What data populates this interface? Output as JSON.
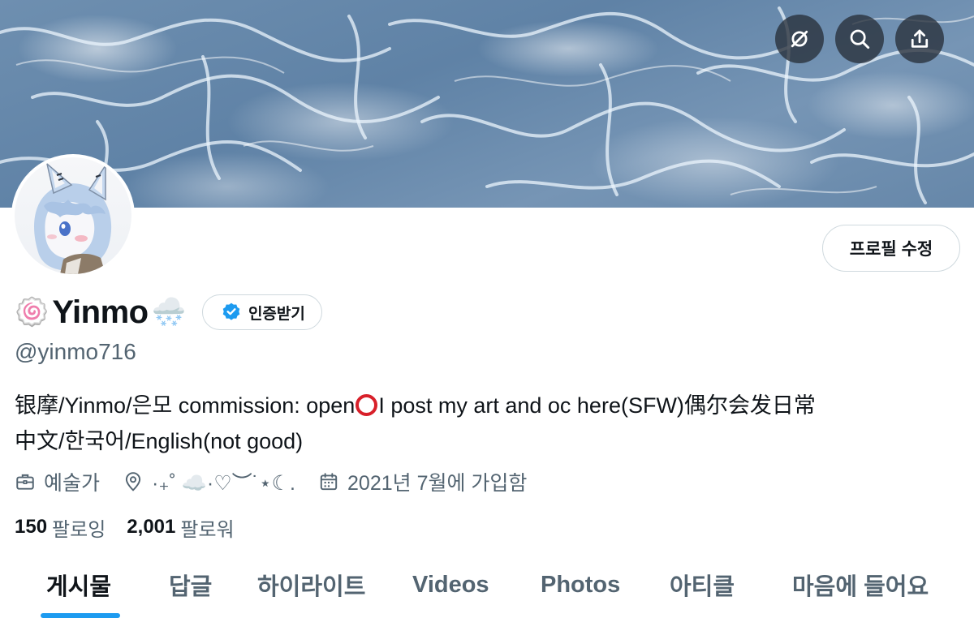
{
  "colors": {
    "accent": "#1d9bf0",
    "text_primary": "#0f1419",
    "text_secondary": "#536471",
    "border": "#cfd9de",
    "open_ring": "#d8202a"
  },
  "header": {
    "icons": [
      "hide-eye-slash-icon",
      "search-icon",
      "share-icon"
    ]
  },
  "profile": {
    "display_name": "Yinmo",
    "name_prefix_emoji": "🍥",
    "name_suffix_emoji": "🌨️",
    "verify_label": "인증받기",
    "edit_profile_label": "프로필 수정",
    "handle": "@yinmo716",
    "bio_part1": "银摩/Yinmo/은모 commission: open",
    "bio_part2": "I post my art and oc here(SFW)偶尔会发日常",
    "bio_line2": "中文/한국어/English(not good)",
    "occupation": "예술가",
    "location": "·₊˚ ☁️·♡︶˙⋆☾.",
    "joined": "2021년 7월에 가입함",
    "following_count": "150",
    "following_label": "팔로잉",
    "followers_count": "2,001",
    "followers_label": "팔로워"
  },
  "tabs": [
    {
      "label": "게시물",
      "active": true
    },
    {
      "label": "답글",
      "active": false
    },
    {
      "label": "하이라이트",
      "active": false
    },
    {
      "label": "Videos",
      "active": false
    },
    {
      "label": "Photos",
      "active": false
    },
    {
      "label": "아티클",
      "active": false
    },
    {
      "label": "마음에 들어요",
      "active": false
    }
  ]
}
